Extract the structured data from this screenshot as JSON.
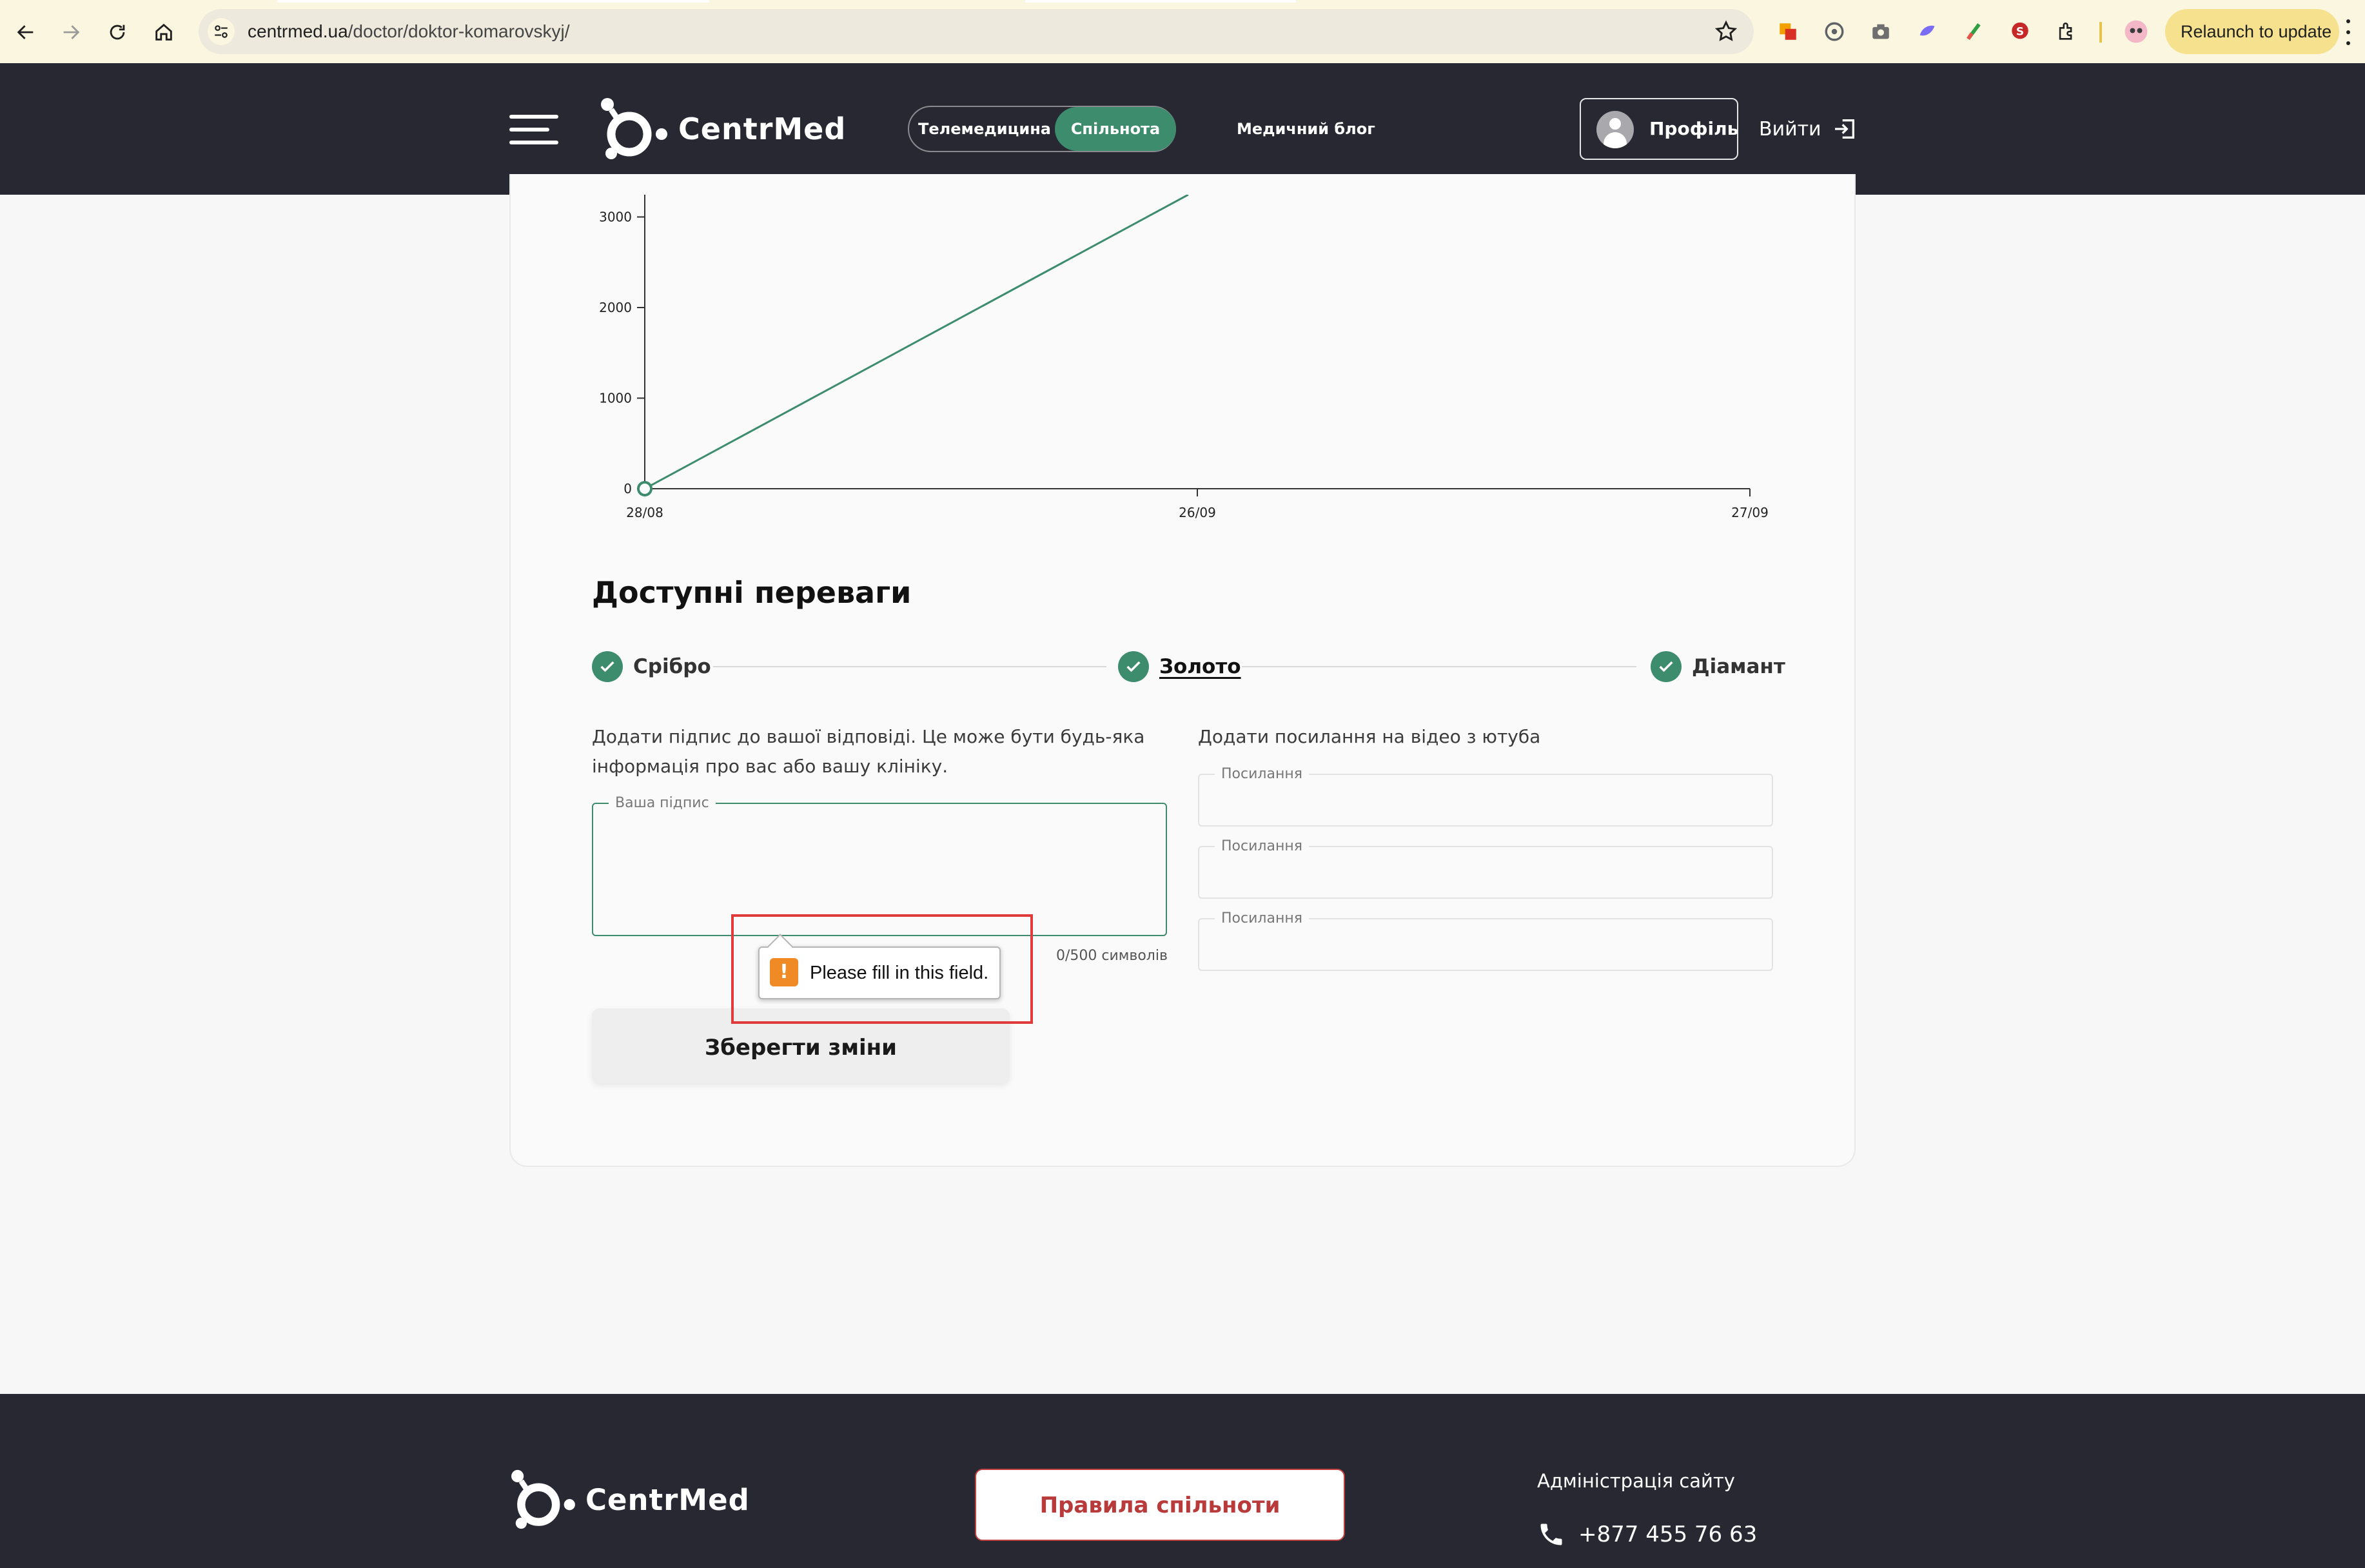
{
  "browser": {
    "url_host": "centrmed.ua",
    "url_path": "/doctor/doktor-komarovskyj/",
    "relaunch_label": "Relaunch to update"
  },
  "header": {
    "logo_text": "CentrMed",
    "switch": {
      "telemedicine": "Телемедицина",
      "community": "Спільнота"
    },
    "blog": "Медичний блог",
    "profile": "Профіль",
    "logout": "Вийти"
  },
  "chart_data": {
    "type": "line",
    "x": [
      "28/08",
      "26/09",
      "27/09"
    ],
    "yticks": [
      0,
      1000,
      2000,
      3000
    ],
    "series": [
      {
        "points": [
          {
            "x": "28/08",
            "y": 0
          },
          {
            "x": "26/09",
            "y": 3300
          }
        ]
      }
    ],
    "line_color": "#3d8c6e"
  },
  "benefits": {
    "title": "Доступні переваги",
    "tiers": [
      {
        "label": "Срібро",
        "active": false
      },
      {
        "label": "Золото",
        "active": true
      },
      {
        "label": "Діамант",
        "active": false
      }
    ]
  },
  "signature": {
    "help_line1": "Додати підпис до вашої відповіді. Це може бути будь-яка",
    "help_line2": "інформація про вас або вашу клініку.",
    "label": "Ваша підпис",
    "value": "",
    "counter": "0/500 символів"
  },
  "video_links": {
    "help": "Додати посилання на відео з ютуба",
    "fields": [
      {
        "label": "Посилання",
        "value": ""
      },
      {
        "label": "Посилання",
        "value": ""
      },
      {
        "label": "Посилання",
        "value": ""
      }
    ]
  },
  "save_button": "Зберегти зміни",
  "validation": {
    "message": "Please fill in this field."
  },
  "footer": {
    "logo_text": "CentrMed",
    "rules_button": "Правила спільноти",
    "admin_label": "Адміністрація сайту",
    "phone": "+877 455 76 63"
  },
  "colors": {
    "accent": "#3d8c6e",
    "dark": "#282832",
    "warning": "#f08a24",
    "highlight": "#e03a3a"
  }
}
